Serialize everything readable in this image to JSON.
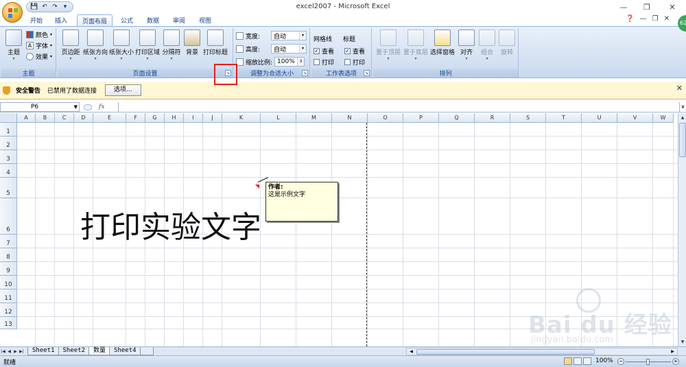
{
  "window": {
    "title": "excel2007 - Microsoft Excel",
    "controls": {
      "minimize": "—",
      "restore": "❐",
      "close": "✕"
    }
  },
  "qat": {
    "save": "💾",
    "undo": "↶",
    "redo": "↷",
    "more": "▾"
  },
  "tabs": [
    {
      "label": "开始"
    },
    {
      "label": "插入"
    },
    {
      "label": "页面布局"
    },
    {
      "label": "公式"
    },
    {
      "label": "数据"
    },
    {
      "label": "审阅"
    },
    {
      "label": "视图"
    }
  ],
  "tabs_right": {
    "help": "❓",
    "min": "—",
    "restore": "❐",
    "close": "✕"
  },
  "avatar": {
    "text": "62"
  },
  "ribbon": {
    "themes": {
      "group_label": "主题",
      "theme_btn": "主题",
      "colors": "颜色",
      "fonts": "字体",
      "effects": "效果"
    },
    "page_setup": {
      "group_label": "页面设置",
      "margins": "页边距",
      "orientation": "纸张方向",
      "size": "纸张大小",
      "print_area": "打印区域",
      "breaks": "分隔符",
      "background": "背景",
      "print_titles": "打印标题"
    },
    "scale_to_fit": {
      "group_label": "调整为合适大小",
      "width_label": "宽度:",
      "width_value": "自动",
      "height_label": "高度:",
      "height_value": "自动",
      "scale_label": "缩放比例:",
      "scale_value": "100%"
    },
    "sheet_options": {
      "group_label": "工作表选项",
      "gridlines": "网格线",
      "headings": "标题",
      "view": "查看",
      "print": "打印"
    },
    "arrange": {
      "group_label": "排列",
      "bring_front": "置于顶层",
      "send_back": "置于底层",
      "selection_pane": "选择窗格",
      "align": "对齐",
      "group": "组合",
      "rotate": "旋转"
    }
  },
  "security_bar": {
    "title": "安全警告",
    "message": "已禁用了数据连接",
    "options_btn": "选项...",
    "close": "✕"
  },
  "formula_bar": {
    "name_box": "P6",
    "fx": "fx",
    "expand": "¥"
  },
  "columns": [
    "A",
    "B",
    "C",
    "D",
    "E",
    "F",
    "G",
    "H",
    "I",
    "J",
    "K",
    "L",
    "M",
    "N",
    "O",
    "P",
    "Q",
    "R",
    "S",
    "T",
    "U",
    "V",
    "W"
  ],
  "rows": [
    "1",
    "2",
    "3",
    "4",
    "5",
    "6",
    "7",
    "8",
    "9",
    "10",
    "11",
    "12",
    "13"
  ],
  "cell_text": "打印实验文字",
  "comment": {
    "author": "作者:",
    "text": "这是示例文字"
  },
  "sheets": [
    {
      "label": "Sheet1"
    },
    {
      "label": "Sheet2"
    },
    {
      "label": "数量"
    },
    {
      "label": "Sheet4"
    }
  ],
  "status": {
    "ready": "就绪",
    "zoom": "100%"
  },
  "watermark": {
    "brand": "Bai du 经验",
    "url": "jingyan.baidu.com"
  }
}
